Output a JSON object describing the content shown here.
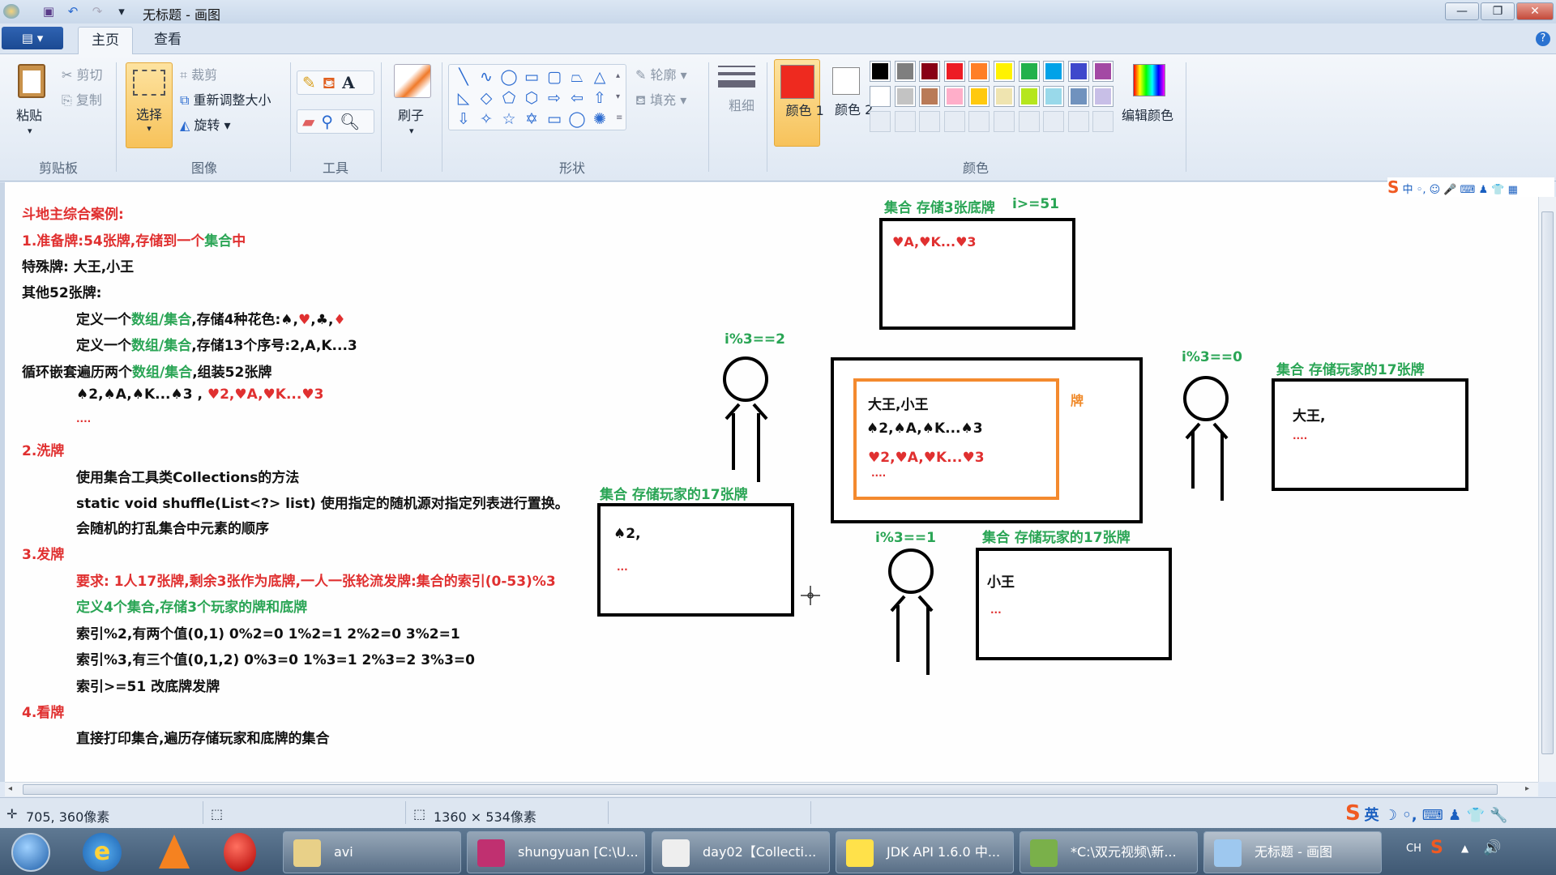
{
  "window": {
    "title": "无标题 - 画图",
    "minimize": "—",
    "maximize": "❐",
    "close": "✕"
  },
  "tabs": {
    "file_menu": "▤ ▾",
    "home": "主页",
    "view": "查看",
    "help": "?"
  },
  "ribbon": {
    "clipboard": {
      "label": "剪贴板",
      "paste": "粘贴",
      "cut": "剪切",
      "copy": "复制"
    },
    "image": {
      "label": "图像",
      "select": "选择",
      "crop": "裁剪",
      "resize": "重新调整大小",
      "rotate": "旋转"
    },
    "tools": {
      "label": "工具"
    },
    "brush": {
      "label": "刷子"
    },
    "shapes": {
      "label": "形状",
      "glyphs": [
        "╲",
        "∿",
        "◯",
        "▭",
        "▢",
        "⏢",
        "△",
        "◺",
        "◇",
        "⬠",
        "⬡",
        "⇨",
        "⇦",
        "⇧",
        "⇩",
        "✧",
        "☆",
        "✡",
        "▭",
        "◯",
        "✺"
      ],
      "outline": "轮廓",
      "fill": "填充"
    },
    "size": {
      "label": "粗细"
    },
    "colors": {
      "label": "颜色",
      "color1": "颜色 1",
      "color2": "颜色 2",
      "edit": "编辑颜色",
      "color1_value": "#ee2a1f",
      "color2_value": "#ffffff",
      "palette_row1": [
        "#000000",
        "#7f7f7f",
        "#880015",
        "#ed1c24",
        "#ff7f27",
        "#fff200",
        "#22b14c",
        "#00a2e8",
        "#3f48cc",
        "#a349a4"
      ],
      "palette_row2": [
        "#ffffff",
        "#c3c3c3",
        "#b97a57",
        "#ffaec9",
        "#ffc90e",
        "#efe4b0",
        "#b5e61d",
        "#99d9ea",
        "#7092be",
        "#c8bfe7"
      ]
    }
  },
  "notes": [
    {
      "text": "斗地主综合案例:",
      "color": "red",
      "indent": 0
    },
    {
      "text": "1.准备牌:54张牌,存储到一个集合中",
      "color": "red",
      "indent": 0
    },
    {
      "text": "特殊牌: 大王,小王",
      "color": "black",
      "indent": 0
    },
    {
      "text": "其他52张牌:",
      "color": "black",
      "indent": 0
    },
    {
      "text": "定义一个数组/集合,存储4种花色:♠,♥,♣,♦",
      "color": "black",
      "indent": 1
    },
    {
      "text": "定义一个数组/集合,存储13个序号:2,A,K...3",
      "color": "black",
      "indent": 1
    },
    {
      "text": "循环嵌套遍历两个数组/集合,组装52张牌",
      "color": "black",
      "indent": 0
    },
    {
      "text": "♠2,♠A,♠K...♠3 , ♥2,♥A,♥K...♥3",
      "color": "black",
      "indent": 1
    },
    {
      "text": "....",
      "color": "red",
      "indent": 1
    },
    {
      "text": "2.洗牌",
      "color": "red",
      "indent": 0
    },
    {
      "text": "使用集合工具类Collections的方法",
      "color": "black",
      "indent": 1
    },
    {
      "text": "static void shuffle(List<?> list) 使用指定的随机源对指定列表进行置换。",
      "color": "black",
      "indent": 1
    },
    {
      "text": "会随机的打乱集合中元素的顺序",
      "color": "black",
      "indent": 1
    },
    {
      "text": "3.发牌",
      "color": "red",
      "indent": 0
    },
    {
      "text": "要求: 1人17张牌,剩余3张作为底牌,一人一张轮流发牌:集合的索引(0-53)%3",
      "color": "red",
      "indent": 1
    },
    {
      "text": "定义4个集合,存储3个玩家的牌和底牌",
      "color": "green",
      "indent": 1
    },
    {
      "text": "索引%2,有两个值(0,1) 0%2=0 1%2=1 2%2=0 3%2=1",
      "color": "black",
      "indent": 1
    },
    {
      "text": "索引%3,有三个值(0,1,2) 0%3=0 1%3=1 2%3=2 3%3=0",
      "color": "black",
      "indent": 1
    },
    {
      "text": "索引>=51 改底牌发牌",
      "color": "black",
      "indent": 1
    },
    {
      "text": "4.看牌",
      "color": "red",
      "indent": 0
    },
    {
      "text": "直接打印集合,遍历存储玩家和底牌的集合",
      "color": "black",
      "indent": 1
    }
  ],
  "diagram": {
    "bottom_cards": {
      "label": "集合 存储3张底牌",
      "cond": "i>=51",
      "content": "♥A,♥K...♥3"
    },
    "deck": {
      "side_label": "牌",
      "line1": "大王,小王",
      "line2": "♠2,♠A,♠K...♠3",
      "line3": "♥2,♥A,♥K...♥3",
      "line4": "...."
    },
    "player0": {
      "cond": "i%3==0",
      "label": "集合 存储玩家的17张牌",
      "content": "大王,",
      "more": "...."
    },
    "player1": {
      "cond": "i%3==1",
      "label": "集合 存储玩家的17张牌",
      "content": "小王",
      "more": "..."
    },
    "player2": {
      "cond": "i%3==2",
      "label": "集合 存储玩家的17张牌",
      "content": "♠2,",
      "more": "..."
    }
  },
  "status": {
    "cursor": "705, 360像素",
    "canvas_size": "1360 × 534像素"
  },
  "ime": {
    "top": "中 ◦, ☺ 🎤 ⌨ ♟ 👕 ▦",
    "bottom": "英 ☽ ◦, ⌨ ♟ 👕 🔧",
    "logo": "S"
  },
  "taskbar": {
    "items": [
      "avi",
      "shungyuan [C:\\U...",
      "day02【Collecti...",
      "JDK API 1.6.0 中...",
      "*C:\\双元视频\\新...",
      "无标题 - 画图"
    ],
    "tray": {
      "lang": "CH",
      "volume": "🔊",
      "arrow": "▲"
    }
  }
}
